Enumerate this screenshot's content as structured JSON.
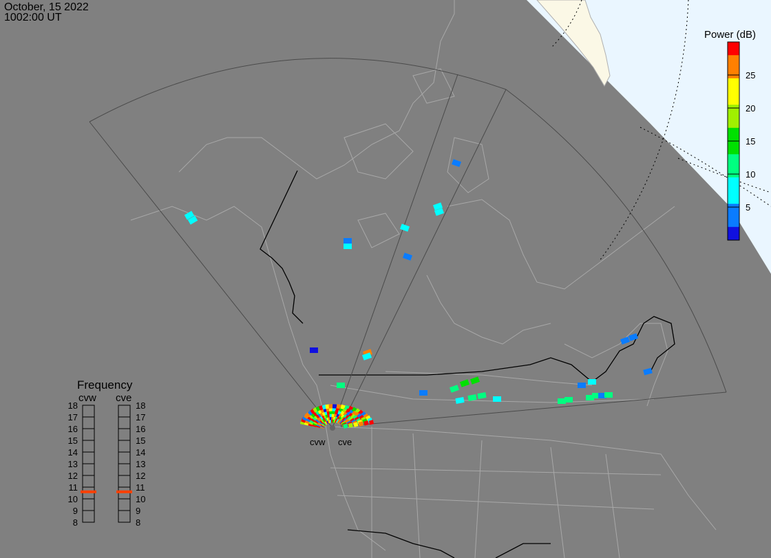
{
  "header": {
    "date": "October, 15 2022",
    "time": "1002:00 UT"
  },
  "colorbar": {
    "title": "Power (dB)",
    "ticks": [
      "5",
      "10",
      "15",
      "20",
      "25"
    ],
    "min": 0,
    "max": 30,
    "colors": [
      "#1010e0",
      "#0a7cff",
      "#00ffff",
      "#00ff80",
      "#00e000",
      "#a0f000",
      "#ffff00",
      "#ff8000",
      "#ff0000"
    ]
  },
  "frequency": {
    "title": "Frequency",
    "radars": [
      "cvw",
      "cve"
    ],
    "scale": [
      "18",
      "17",
      "16",
      "15",
      "14",
      "13",
      "12",
      "11",
      "10",
      "9",
      "8"
    ],
    "values_mhz": [
      10.6,
      10.6
    ],
    "marker_color": "#ff4000"
  },
  "sites": [
    {
      "name": "cvw"
    },
    {
      "name": "cve"
    }
  ],
  "colors": {
    "background": "#808080",
    "polar_region": "#eaf6ff",
    "land_polar": "#fbf8e6",
    "coast": "#a8a8a8",
    "border": "#000000"
  }
}
